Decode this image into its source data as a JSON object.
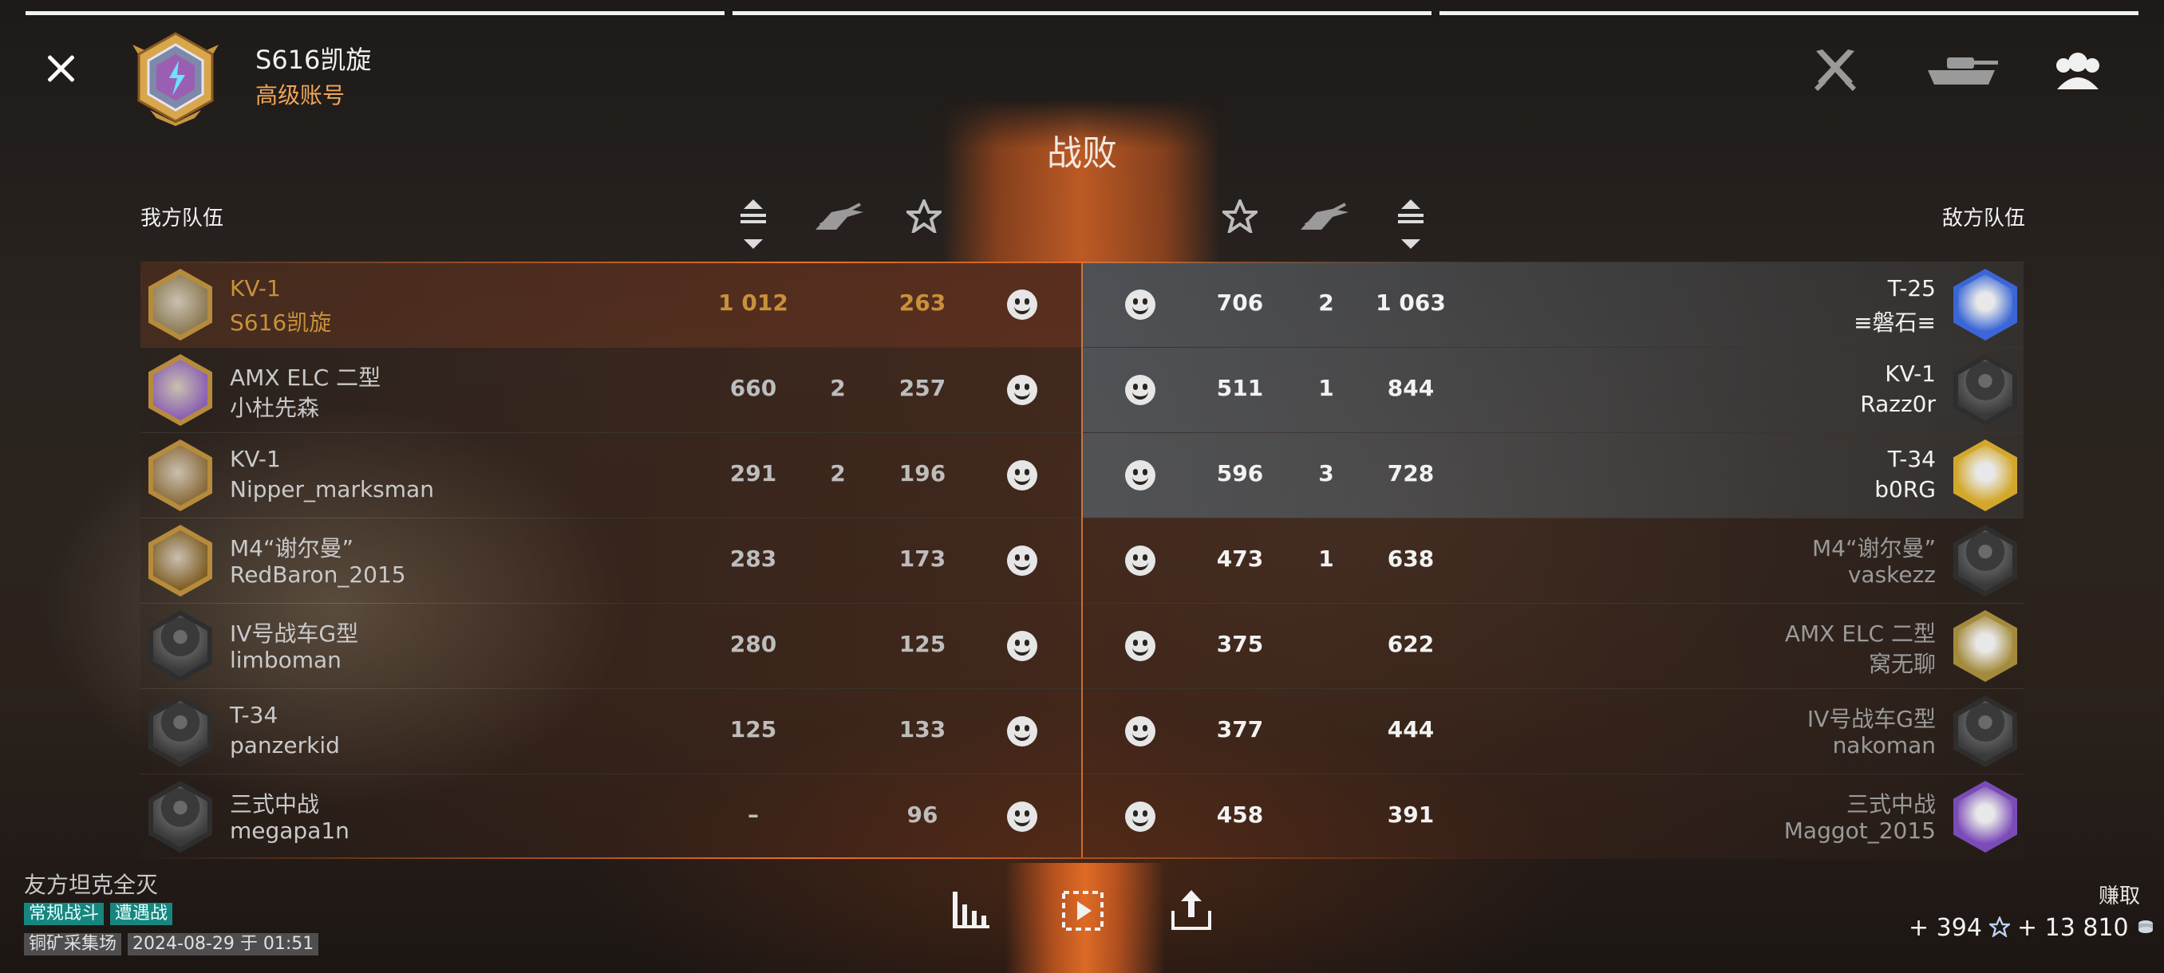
{
  "header": {
    "player_name": "S616凯旋",
    "account_type": "高级账号",
    "result": "战败"
  },
  "icons": {
    "close": "close-icon",
    "player_emblem": "rank-emblem-icon",
    "top_right": [
      "crossed-swords-icon",
      "tank-icon",
      "team-icon"
    ],
    "headers_left": [
      "xp-arrows-icon",
      "kills-icon",
      "star-icon"
    ],
    "headers_right": [
      "star-icon",
      "kills-icon",
      "xp-arrows-icon"
    ],
    "bottom": [
      "stats-icon",
      "replay-icon",
      "share-icon"
    ],
    "reputation": "smiley-icon"
  },
  "teams": {
    "left_label": "我方队伍",
    "right_label": "敌方队伍"
  },
  "left_team": [
    {
      "tank": "KV-1",
      "player": "S616凯旋",
      "damage": "1 012",
      "kills": "",
      "score": "263",
      "highlight": true
    },
    {
      "tank": "AMX ELC 二型",
      "player": "小杜先森",
      "damage": "660",
      "kills": "2",
      "score": "257"
    },
    {
      "tank": "KV-1",
      "player": "Nipper_marksman",
      "damage": "291",
      "kills": "2",
      "score": "196"
    },
    {
      "tank": "M4“谢尔曼”",
      "player": "RedBaron_2015",
      "damage": "283",
      "kills": "",
      "score": "173"
    },
    {
      "tank": "IV号战车G型",
      "player": "limboman",
      "damage": "280",
      "kills": "",
      "score": "125"
    },
    {
      "tank": "T-34",
      "player": "panzerkid",
      "damage": "125",
      "kills": "",
      "score": "133"
    },
    {
      "tank": "三式中战",
      "player": "megapa1n",
      "damage": "–",
      "kills": "",
      "score": "96"
    }
  ],
  "right_team": [
    {
      "tank": "T-25",
      "player": "≡磐石≡",
      "score": "706",
      "kills": "2",
      "damage": "1 063"
    },
    {
      "tank": "KV-1",
      "player": "Razz0r",
      "score": "511",
      "kills": "1",
      "damage": "844"
    },
    {
      "tank": "T-34",
      "player": "b0RG",
      "score": "596",
      "kills": "3",
      "damage": "728"
    },
    {
      "tank": "M4“谢尔曼”",
      "player": "vaskezz",
      "score": "473",
      "kills": "1",
      "damage": "638"
    },
    {
      "tank": "AMX ELC 二型",
      "player": "窝无聊",
      "score": "375",
      "kills": "",
      "damage": "622"
    },
    {
      "tank": "IV号战车G型",
      "player": "nakoman",
      "score": "377",
      "kills": "",
      "damage": "444"
    },
    {
      "tank": "三式中战",
      "player": "Maggot_2015",
      "score": "458",
      "kills": "",
      "damage": "391"
    }
  ],
  "footer": {
    "result_reason": "友方坦克全灭",
    "battle_type": "常规战斗",
    "mode": "遭遇战",
    "map": "铜矿采集场",
    "datetime": "2024-08-29 于 01:51",
    "earned_label": "赚取",
    "xp": "+ 394",
    "credits": "+ 13 810"
  },
  "colors": {
    "accent_orange": "#f0a55a",
    "highlight_gold": "#c8913a",
    "tag_teal": "#17867f",
    "divider_orange": "#ff8c3c"
  }
}
